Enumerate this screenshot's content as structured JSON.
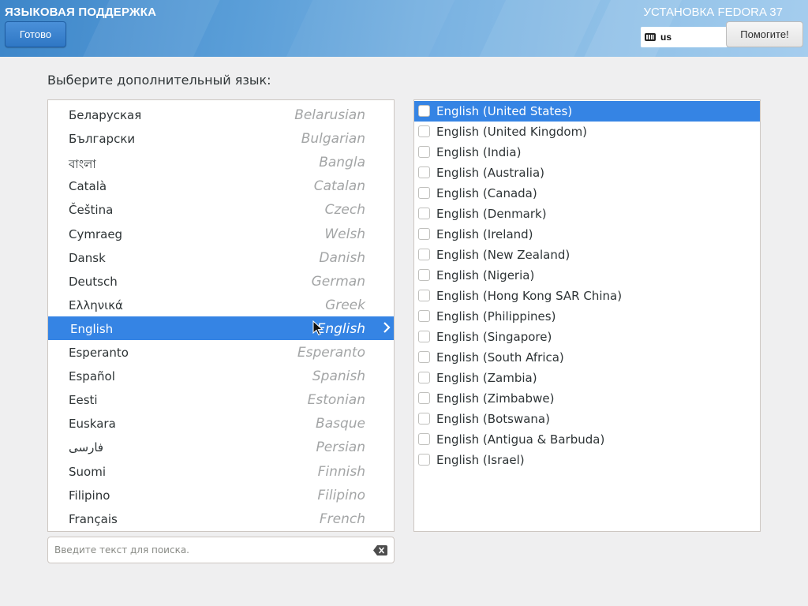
{
  "header": {
    "spoke_title": "ЯЗЫКОВАЯ ПОДДЕРЖКА",
    "done_label": "Готово",
    "product_title": "УСТАНОВКА FEDORA 37",
    "keyboard_layout": "us",
    "help_label": "Помогите!"
  },
  "prompt": "Выберите дополнительный язык:",
  "languages": [
    {
      "native": "Беларуская",
      "english": "Belarusian"
    },
    {
      "native": "Български",
      "english": "Bulgarian"
    },
    {
      "native": "বাংলা",
      "english": "Bangla"
    },
    {
      "native": "Català",
      "english": "Catalan"
    },
    {
      "native": "Čeština",
      "english": "Czech"
    },
    {
      "native": "Cymraeg",
      "english": "Welsh"
    },
    {
      "native": "Dansk",
      "english": "Danish"
    },
    {
      "native": "Deutsch",
      "english": "German"
    },
    {
      "native": "Ελληνικά",
      "english": "Greek"
    },
    {
      "native": "English",
      "english": "English",
      "selected": true
    },
    {
      "native": "Esperanto",
      "english": "Esperanto"
    },
    {
      "native": "Español",
      "english": "Spanish"
    },
    {
      "native": "Eesti",
      "english": "Estonian"
    },
    {
      "native": "Euskara",
      "english": "Basque"
    },
    {
      "native": "فارسی",
      "english": "Persian"
    },
    {
      "native": "Suomi",
      "english": "Finnish"
    },
    {
      "native": "Filipino",
      "english": "Filipino"
    },
    {
      "native": "Français",
      "english": "French"
    }
  ],
  "search": {
    "placeholder": "Введите текст для поиска.",
    "value": ""
  },
  "locales": [
    {
      "label": "English (United States)",
      "selected": true,
      "checked": false
    },
    {
      "label": "English (United Kingdom)",
      "checked": false
    },
    {
      "label": "English (India)",
      "checked": false
    },
    {
      "label": "English (Australia)",
      "checked": false
    },
    {
      "label": "English (Canada)",
      "checked": false
    },
    {
      "label": "English (Denmark)",
      "checked": false
    },
    {
      "label": "English (Ireland)",
      "checked": false
    },
    {
      "label": "English (New Zealand)",
      "checked": false
    },
    {
      "label": "English (Nigeria)",
      "checked": false
    },
    {
      "label": "English (Hong Kong SAR China)",
      "checked": false
    },
    {
      "label": "English (Philippines)",
      "checked": false
    },
    {
      "label": "English (Singapore)",
      "checked": false
    },
    {
      "label": "English (South Africa)",
      "checked": false
    },
    {
      "label": "English (Zambia)",
      "checked": false
    },
    {
      "label": "English (Zimbabwe)",
      "checked": false
    },
    {
      "label": "English (Botswana)",
      "checked": false
    },
    {
      "label": "English (Antigua & Barbuda)",
      "checked": false
    },
    {
      "label": "English (Israel)",
      "checked": false
    }
  ],
  "colors": {
    "accent": "#3584e4",
    "header_start": "#3d86c9",
    "header_end": "#a5cdee"
  },
  "icons": {
    "keyboard": "keyboard-icon",
    "row_arrow": "chevron-right-icon",
    "clear": "edit-clear-icon",
    "pointer": "mouse-pointer-icon"
  }
}
